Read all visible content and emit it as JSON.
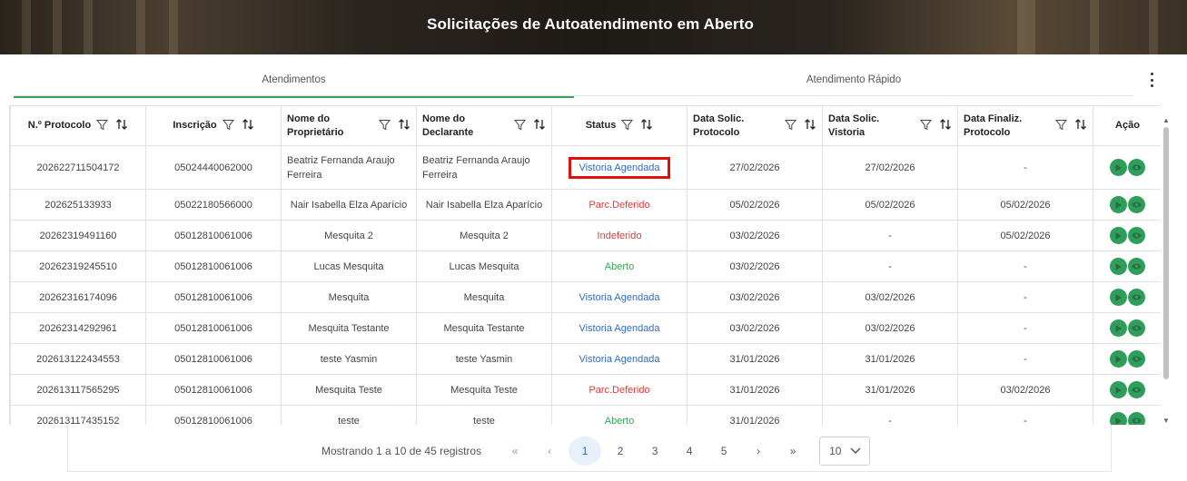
{
  "banner": {
    "title": "Solicitações de Autoatendimento em Aberto"
  },
  "tabs": [
    {
      "label": "Atendimentos",
      "active": true
    },
    {
      "label": "Atendimento Rápido",
      "active": false
    }
  ],
  "table": {
    "columns": [
      "N.º Protocolo",
      "Inscrição",
      "Nome do Proprietário",
      "Nome do Declarante",
      "Status",
      "Data Solic. Protocolo",
      "Data Solic. Vistoria",
      "Data Finaliz. Protocolo",
      "Ação"
    ],
    "rows": [
      {
        "protocolo": "202622711504172",
        "inscricao": "05024440062000",
        "proprietario": "Beatriz Fernanda Araujo Ferreira",
        "declarante": "Beatriz Fernanda Araujo Ferreira",
        "status": "Vistoria Agendada",
        "data_protocolo": "27/02/2026",
        "data_vistoria": "27/02/2026",
        "data_finaliz": "-"
      },
      {
        "protocolo": "202625133933",
        "inscricao": "05022180566000",
        "proprietario": "Nair Isabella Elza Aparício",
        "declarante": "Nair Isabella Elza Aparício",
        "status": "Parc.Deferido",
        "data_protocolo": "05/02/2026",
        "data_vistoria": "05/02/2026",
        "data_finaliz": "05/02/2026"
      },
      {
        "protocolo": "20262319491160",
        "inscricao": "05012810061006",
        "proprietario": "Mesquita 2",
        "declarante": "Mesquita 2",
        "status": "Indeferido",
        "data_protocolo": "03/02/2026",
        "data_vistoria": "-",
        "data_finaliz": "05/02/2026"
      },
      {
        "protocolo": "20262319245510",
        "inscricao": "05012810061006",
        "proprietario": "Lucas Mesquita",
        "declarante": "Lucas Mesquita",
        "status": "Aberto",
        "data_protocolo": "03/02/2026",
        "data_vistoria": "-",
        "data_finaliz": "-"
      },
      {
        "protocolo": "20262316174096",
        "inscricao": "05012810061006",
        "proprietario": "Mesquita",
        "declarante": "Mesquita",
        "status": "Vistoria Agendada",
        "data_protocolo": "03/02/2026",
        "data_vistoria": "03/02/2026",
        "data_finaliz": "-"
      },
      {
        "protocolo": "20262314292961",
        "inscricao": "05012810061006",
        "proprietario": "Mesquita Testante",
        "declarante": "Mesquita Testante",
        "status": "Vistoria Agendada",
        "data_protocolo": "03/02/2026",
        "data_vistoria": "03/02/2026",
        "data_finaliz": "-"
      },
      {
        "protocolo": "202613122434553",
        "inscricao": "05012810061006",
        "proprietario": "teste Yasmin",
        "declarante": "teste Yasmin",
        "status": "Vistoria Agendada",
        "data_protocolo": "31/01/2026",
        "data_vistoria": "31/01/2026",
        "data_finaliz": "-"
      },
      {
        "protocolo": "202613117565295",
        "inscricao": "05012810061006",
        "proprietario": "Mesquita Teste",
        "declarante": "Mesquita Teste",
        "status": "Parc.Deferido",
        "data_protocolo": "31/01/2026",
        "data_vistoria": "31/01/2026",
        "data_finaliz": "03/02/2026"
      },
      {
        "protocolo": "202613117435152",
        "inscricao": "05012810061006",
        "proprietario": "teste",
        "declarante": "teste",
        "status": "Aberto",
        "data_protocolo": "31/01/2026",
        "data_vistoria": "-",
        "data_finaliz": "-"
      }
    ],
    "actions": [
      "play-icon",
      "eye-icon"
    ]
  },
  "status_colors": {
    "Vistoria Agendada": "#2d6cc7",
    "Parc.Deferido": "#e53935",
    "Indeferido": "#e53935",
    "Aberto": "#3aa057"
  },
  "pagination": {
    "info": "Mostrando 1 a 10 de 45 registros",
    "first": "«",
    "prev": "‹",
    "pages": [
      "1",
      "2",
      "3",
      "4",
      "5"
    ],
    "current": "1",
    "next": "›",
    "last": "»",
    "page_size": "10"
  }
}
